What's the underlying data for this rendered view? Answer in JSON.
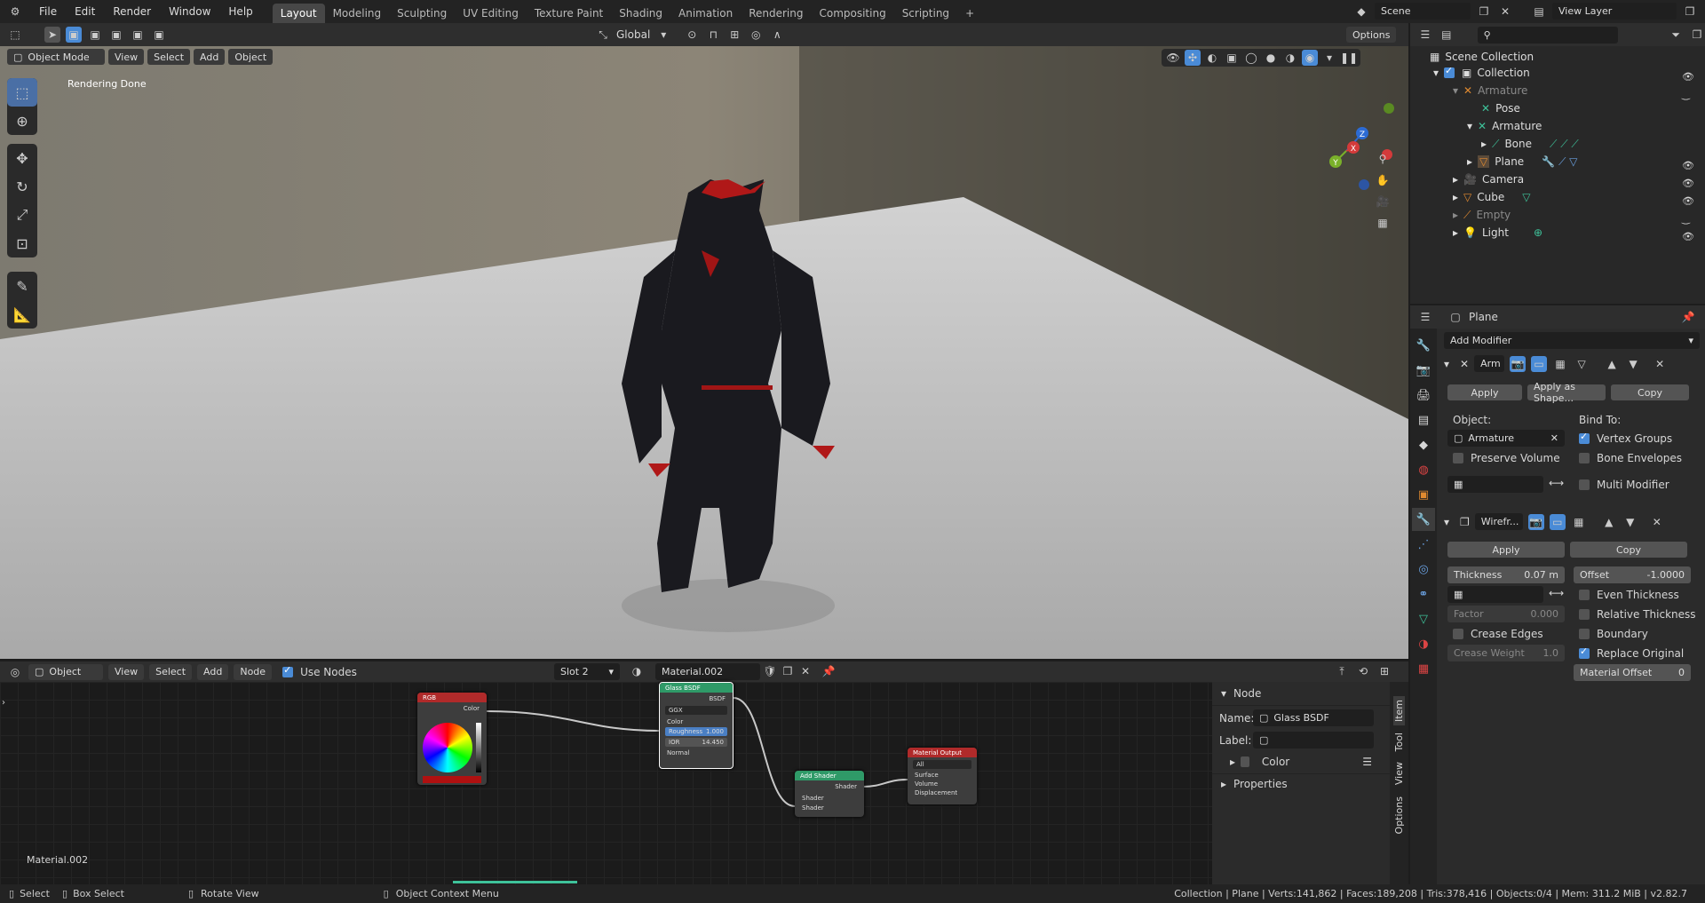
{
  "topbar": {
    "menus": [
      "File",
      "Edit",
      "Render",
      "Window",
      "Help"
    ],
    "workspaces": [
      "Layout",
      "Modeling",
      "Sculpting",
      "UV Editing",
      "Texture Paint",
      "Shading",
      "Animation",
      "Rendering",
      "Compositing",
      "Scripting"
    ],
    "active": "Layout",
    "add": "+",
    "scene": "Scene",
    "view_layer": "View Layer"
  },
  "viewport": {
    "mode": "Object Mode",
    "menus": [
      "View",
      "Select",
      "Add",
      "Object"
    ],
    "transform": "Global",
    "options": "Options",
    "overlay_text": "Rendering Done",
    "gizmo": {
      "x": "X",
      "y": "Y",
      "z": "Z"
    }
  },
  "outliner": {
    "search": "",
    "items": [
      {
        "label": "Scene Collection",
        "dim": false
      },
      {
        "label": "Collection",
        "dim": false
      },
      {
        "label": "Armature",
        "dim": true
      },
      {
        "label": "Pose",
        "dim": false
      },
      {
        "label": "Armature",
        "dim": false
      },
      {
        "label": "Bone",
        "dim": false
      },
      {
        "label": "Plane",
        "dim": false
      },
      {
        "label": "Camera",
        "dim": false
      },
      {
        "label": "Cube",
        "dim": false
      },
      {
        "label": "Empty",
        "dim": true
      },
      {
        "label": "Light",
        "dim": false
      }
    ]
  },
  "properties": {
    "object": "Plane",
    "add_modifier": "Add Modifier",
    "mod1": {
      "name": "Arm",
      "apply": "Apply",
      "apply_shape": "Apply as Shape...",
      "copy": "Copy",
      "object_label": "Object:",
      "object_value": "Armature",
      "bind_to": "Bind To:",
      "preserve_volume": "Preserve Volume",
      "vertex_groups": "Vertex Groups",
      "bone_envelopes": "Bone Envelopes",
      "multi_modifier": "Multi Modifier"
    },
    "mod2": {
      "name": "Wirefr...",
      "apply": "Apply",
      "copy": "Copy",
      "thickness_label": "Thickness",
      "thickness": "0.07 m",
      "offset_label": "Offset",
      "offset": "-1.0000",
      "even_thickness": "Even Thickness",
      "relative_thickness": "Relative Thickness",
      "factor_label": "Factor",
      "factor": "0.000",
      "crease_edges": "Crease Edges",
      "boundary": "Boundary",
      "crease_weight_label": "Crease Weight",
      "crease_weight": "1.0",
      "replace_original": "Replace Original",
      "material_offset_label": "Material Offset",
      "material_offset": "0"
    }
  },
  "nodeeditor": {
    "type": "Object",
    "menus": [
      "View",
      "Select",
      "Add",
      "Node"
    ],
    "use_nodes": "Use Nodes",
    "slot": "Slot 2",
    "material": "Material.002",
    "footer_label": "Material.002",
    "nodes": {
      "rgb": {
        "title": "RGB",
        "out": "Color"
      },
      "glass": {
        "title": "Glass BSDF",
        "out": "BSDF",
        "dist": "GGX",
        "color": "Color",
        "roughness_label": "Roughness",
        "roughness": "1.000",
        "ior_label": "IOR",
        "ior": "14.450",
        "normal": "Normal"
      },
      "add": {
        "title": "Add Shader",
        "out": "Shader",
        "in1": "Shader",
        "in2": "Shader"
      },
      "output": {
        "title": "Material Output",
        "target": "All",
        "surface": "Surface",
        "volume": "Volume",
        "displacement": "Displacement"
      }
    },
    "sidebar": {
      "node_header": "Node",
      "name_label": "Name:",
      "name_value": "Glass BSDF",
      "label_label": "Label:",
      "label_value": "",
      "color": "Color",
      "properties": "Properties",
      "tabs": [
        "Item",
        "Tool",
        "View",
        "Options"
      ]
    }
  },
  "status": {
    "select": "Select",
    "box_select": "Box Select",
    "rotate": "Rotate View",
    "context": "Object Context Menu",
    "stats": "Collection | Plane | Verts:141,862 | Faces:189,208 | Tris:378,416 | Objects:0/4 | Mem: 311.2 MiB | v2.82.7"
  }
}
